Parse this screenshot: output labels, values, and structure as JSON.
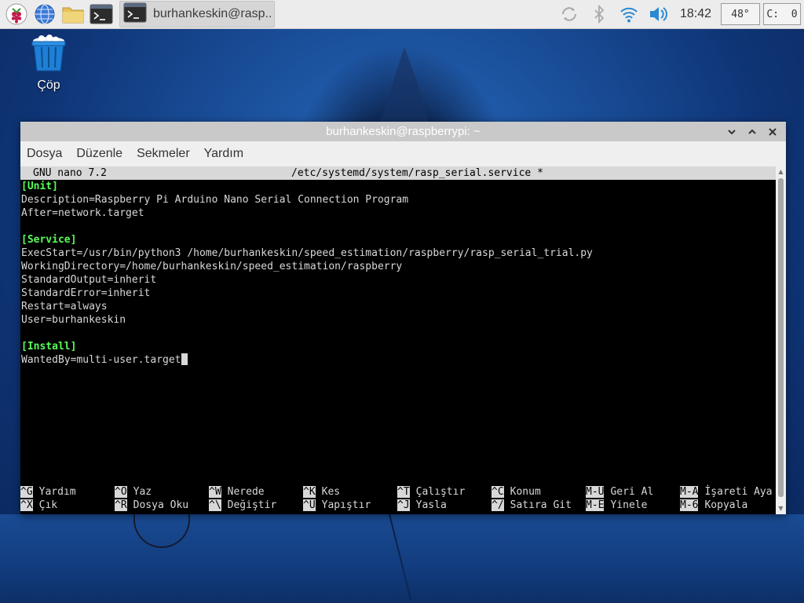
{
  "taskbar": {
    "launcher_icons": [
      "raspberry-menu-icon",
      "web-browser-icon",
      "file-manager-icon",
      "terminal-icon"
    ],
    "task": {
      "label": "burhankeskin@rasp..",
      "icon": "terminal-icon"
    },
    "tray": {
      "icons": [
        "sync-icon",
        "bluetooth-icon",
        "wifi-icon",
        "volume-icon"
      ],
      "clock": "18:42",
      "temperature": "48°",
      "cpu": "C:  0"
    }
  },
  "desktop": {
    "trash_label": "Çöp"
  },
  "window": {
    "title": "burhankeskin@raspberrypi: ~",
    "buttons": [
      "chevron-down-icon",
      "chevron-up-icon",
      "close-icon"
    ],
    "menu": [
      "Dosya",
      "Düzenle",
      "Sekmeler",
      "Yardım"
    ]
  },
  "nano": {
    "version": "GNU nano 7.2",
    "filename": "/etc/systemd/system/rasp_serial.service *",
    "lines": [
      {
        "text": "[Unit]",
        "section": true
      },
      {
        "text": "Description=Raspberry Pi Arduino Nano Serial Connection Program",
        "section": false
      },
      {
        "text": "After=network.target",
        "section": false
      },
      {
        "text": "",
        "section": false
      },
      {
        "text": "[Service]",
        "section": true
      },
      {
        "text": "ExecStart=/usr/bin/python3 /home/burhankeskin/speed_estimation/raspberry/rasp_serial_trial.py",
        "section": false
      },
      {
        "text": "WorkingDirectory=/home/burhankeskin/speed_estimation/raspberry",
        "section": false
      },
      {
        "text": "StandardOutput=inherit",
        "section": false
      },
      {
        "text": "StandardError=inherit",
        "section": false
      },
      {
        "text": "Restart=always",
        "section": false
      },
      {
        "text": "User=burhankeskin",
        "section": false
      },
      {
        "text": "",
        "section": false
      },
      {
        "text": "[Install]",
        "section": true
      },
      {
        "text": "WantedBy=multi-user.target",
        "section": false,
        "cursor": true
      }
    ],
    "help_rows": [
      [
        {
          "key": "^G",
          "label": "Yardım"
        },
        {
          "key": "^O",
          "label": "Yaz"
        },
        {
          "key": "^W",
          "label": "Nerede"
        },
        {
          "key": "^K",
          "label": "Kes"
        },
        {
          "key": "^T",
          "label": "Çalıştır"
        },
        {
          "key": "^C",
          "label": "Konum"
        },
        {
          "key": "M-U",
          "label": "Geri Al"
        },
        {
          "key": "M-A",
          "label": "İşareti Aya"
        }
      ],
      [
        {
          "key": "^X",
          "label": "Çık"
        },
        {
          "key": "^R",
          "label": "Dosya Oku"
        },
        {
          "key": "^\\",
          "label": "Değiştir"
        },
        {
          "key": "^U",
          "label": "Yapıştır"
        },
        {
          "key": "^J",
          "label": "Yasla"
        },
        {
          "key": "^/",
          "label": "Satıra Git"
        },
        {
          "key": "M-E",
          "label": "Yinele"
        },
        {
          "key": "M-6",
          "label": "Kopyala"
        }
      ]
    ]
  }
}
